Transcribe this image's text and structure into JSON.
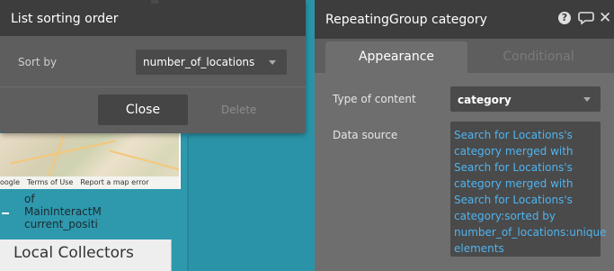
{
  "sort_popup": {
    "title": "List sorting order",
    "sort_by_label": "Sort by",
    "sort_by_value": "number_of_locations",
    "close_label": "Close",
    "delete_label": "Delete"
  },
  "background": {
    "map_footer": [
      "oogle",
      "Terms of Use",
      "Report a map error"
    ],
    "text_element": "of\nMainInteractM\ncurrent_positi",
    "local_label": "Local Collectors"
  },
  "prop_panel": {
    "title": "RepeatingGroup category",
    "tabs": [
      {
        "label": "Appearance",
        "active": true
      },
      {
        "label": "Conditional",
        "active": false
      }
    ],
    "type_of_content_label": "Type of content",
    "type_of_content_value": "category",
    "data_source_label": "Data source",
    "data_source_value": "Search for Locations's\ncategory merged with\nSearch for Locations's\ncategory merged with\nSearch for Locations's\ncategory:sorted by\nnumber_of_locations:unique\nelements",
    "icons": [
      "help-icon",
      "comment-icon",
      "close-icon"
    ]
  },
  "colors": {
    "canvas": "#2b93a8",
    "panel": "#5e5e5e",
    "header": "#3d3d3d",
    "link": "#4fb4f0"
  }
}
